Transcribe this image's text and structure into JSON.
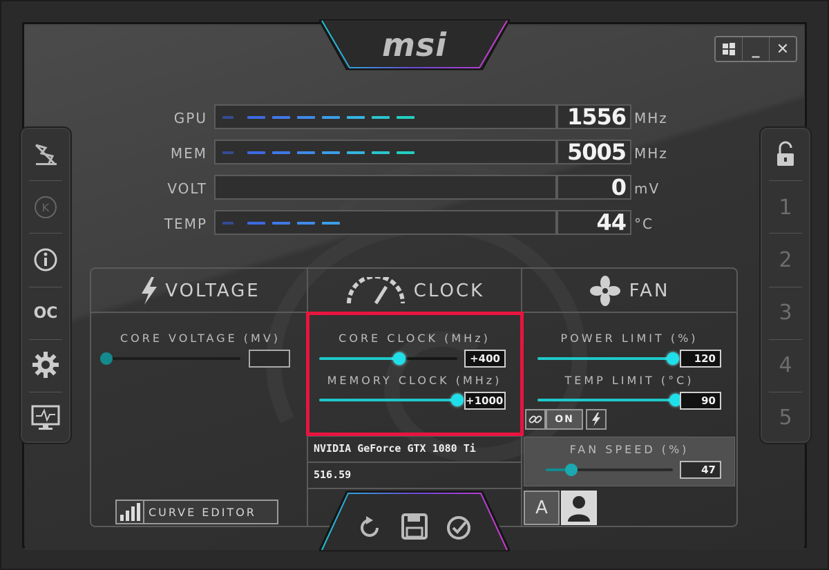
{
  "app": {
    "logo": "msi"
  },
  "window_controls": {
    "windows_icon": "windows-icon",
    "minimize": "_",
    "close": "✕"
  },
  "left_sidebar": [
    {
      "icon": "lightning-fan-icon"
    },
    {
      "icon": "k-circle-icon",
      "glyph": "K"
    },
    {
      "icon": "info-icon"
    },
    {
      "icon": "oc-scanner-icon",
      "glyph": "OC"
    },
    {
      "icon": "gear-icon"
    },
    {
      "icon": "monitor-pulse-icon"
    }
  ],
  "profiles": {
    "lock_icon": "unlock-icon",
    "items": [
      "1",
      "2",
      "3",
      "4",
      "5"
    ]
  },
  "monitor": [
    {
      "label": "GPU",
      "value": "1556",
      "unit": "MHz",
      "level": 0.6
    },
    {
      "label": "MEM",
      "value": "5005",
      "unit": "MHz",
      "level": 0.66
    },
    {
      "label": "VOLT",
      "value": "0",
      "unit": "mV",
      "level": 0
    },
    {
      "label": "TEMP",
      "value": "44",
      "unit": "°C",
      "level": 0.44
    }
  ],
  "sections": {
    "voltage": {
      "title": "VOLTAGE"
    },
    "clock": {
      "title": "CLOCK"
    },
    "fan": {
      "title": "FAN"
    }
  },
  "voltage": {
    "core_voltage_label": "CORE VOLTAGE  (MV)",
    "core_voltage_value": "",
    "level": 0
  },
  "clock": {
    "core_clock_label": "CORE CLOCK (MHz)",
    "core_clock_value": "+400",
    "core_level": 0.58,
    "memory_clock_label": "MEMORY CLOCK (MHz)",
    "memory_clock_value": "+1000",
    "memory_level": 1.0
  },
  "fan": {
    "power_limit_label": "POWER LIMIT (%)",
    "power_limit_value": "120",
    "power_level": 1.0,
    "temp_limit_label": "TEMP LIMIT (°C)",
    "temp_limit_value": "90",
    "temp_level": 1.0,
    "link_on_label": "ON",
    "fan_speed_label": "FAN SPEED (%)",
    "fan_speed_value": "47",
    "fan_level": 0.2
  },
  "gpu_info": {
    "name": "NVIDIA GeForce GTX 1080 Ti",
    "driver": "516.59"
  },
  "curve_editor_label": "CURVE EDITOR",
  "fan_mode": {
    "auto_label": "A"
  },
  "colors": {
    "accent": "#1fe0ea",
    "highlight": "#e8143f"
  }
}
